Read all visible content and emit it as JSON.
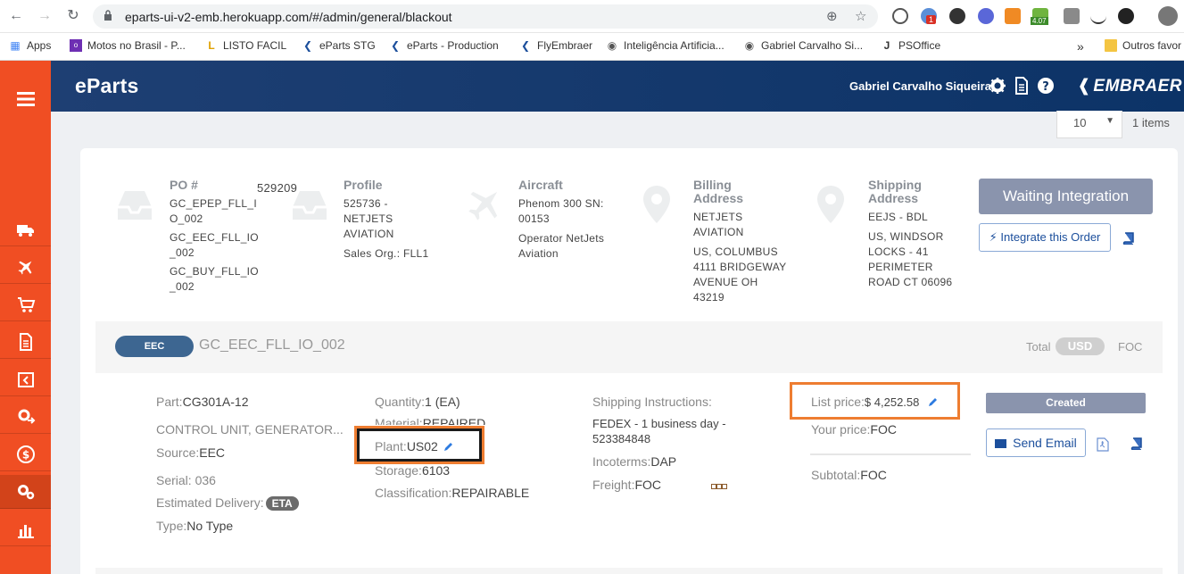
{
  "browser": {
    "url": "eparts-ui-v2-emb.herokuapp.com/#/admin/general/blackout",
    "ext_badge_1": "1",
    "ext_badge_2": "4.07",
    "bookmarks": [
      {
        "label": "Apps",
        "icon": "apps-grid-icon"
      },
      {
        "label": "Motos no Brasil - P...",
        "icon": "olx-icon"
      },
      {
        "label": "LISTO FACIL",
        "icon": "listo-icon"
      },
      {
        "label": "eParts STG",
        "icon": "embraer-icon"
      },
      {
        "label": "eParts - Production",
        "icon": "embraer-icon"
      },
      {
        "label": "FlyEmbraer",
        "icon": "embraer-icon"
      },
      {
        "label": "Inteligência Artificia...",
        "icon": "globe-icon"
      },
      {
        "label": "Gabriel Carvalho Si...",
        "icon": "globe-icon"
      },
      {
        "label": "PSOffice",
        "icon": "psoffice-icon"
      }
    ],
    "bookmarks_overflow": "»",
    "other_bookmarks": "Outros favor"
  },
  "header": {
    "brand": "eParts",
    "user": "Gabriel Carvalho Siqueira",
    "logo": "EMBRAER"
  },
  "pagination": {
    "per_page": "10",
    "items": "1 items"
  },
  "order": {
    "po_label": "PO #",
    "po_number": "529209",
    "po_lines": [
      "GC_EPEP_FLL_I",
      "O_002",
      "GC_EEC_FLL_IO",
      "_002",
      "GC_BUY_FLL_IO",
      "_002"
    ],
    "profile_label": "Profile",
    "profile_lines": [
      "525736 -",
      "NETJETS",
      "AVIATION",
      "Sales Org.: FLL1"
    ],
    "aircraft_label": "Aircraft",
    "aircraft_lines": [
      "Phenom 300 SN:",
      "00153",
      "Operator NetJets",
      "Aviation"
    ],
    "billing_label_1": "Billing",
    "billing_label_2": "Address",
    "billing_lines": [
      "NETJETS",
      "AVIATION",
      "US, COLUMBUS",
      "4111 BRIDGEWAY",
      "AVENUE OH",
      "43219"
    ],
    "shipping_label_1": "Shipping",
    "shipping_label_2": "Address",
    "shipping_lines": [
      "EEJS - BDL",
      "US, WINDSOR",
      "LOCKS - 41",
      "PERIMETER",
      "ROAD CT 06096"
    ],
    "status_button": "Waiting Integration",
    "integrate_button": "Integrate this Order"
  },
  "sub_order": {
    "tag": "EEC",
    "code": "GC_EEC_FLL_IO_002",
    "total_label": "Total",
    "currency": "USD",
    "foc": "FOC"
  },
  "item": {
    "part_label": "Part:",
    "part": "CG301A-12",
    "description": "CONTROL UNIT, GENERATOR...",
    "source_label": "Source:",
    "source": "EEC",
    "serial_label": "Serial:",
    "serial": "036",
    "delivery_label": "Estimated Delivery:",
    "eta": "ETA",
    "type_label": "Type:",
    "type": "No Type",
    "quantity_label": "Quantity:",
    "quantity": "1 (EA)",
    "material_label": "Material:",
    "material": "REPAIRED",
    "plant_label": "Plant:",
    "plant": "US02",
    "storage_label": "Storage:",
    "storage": "6103",
    "classification_label": "Classification:",
    "classification": "REPAIRABLE",
    "shipping_instr_label": "Shipping Instructions:",
    "shipping_instr_1": "FEDEX - 1 business day -",
    "shipping_instr_2": "523384848",
    "incoterms_label": "Incoterms:",
    "incoterms": "DAP",
    "freight_label": "Freight:",
    "freight": "FOC",
    "list_price_label": "List price:",
    "list_price": "$ 4,252.58",
    "your_price_label": "Your price:",
    "your_price": "FOC",
    "subtotal_label": "Subtotal:",
    "subtotal": "FOC",
    "status": "Created",
    "send_email": "Send Email"
  },
  "colors": {
    "sidebar": "#f04e23",
    "header": "#0c3367",
    "highlight": "#ee7d31",
    "button_gray_blue": "#8a94ad"
  }
}
